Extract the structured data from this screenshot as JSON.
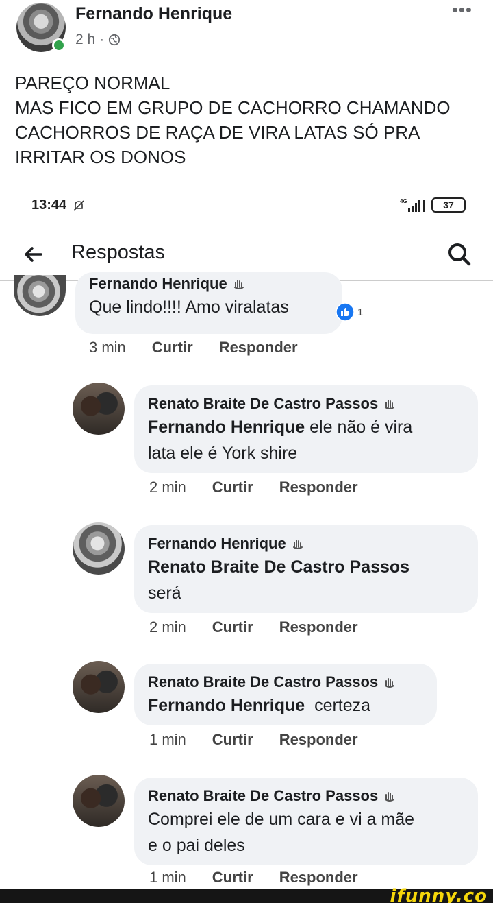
{
  "post": {
    "author": "Fernando Henrique",
    "time": "2 h",
    "separator": "·",
    "more": "•••",
    "text_lines": [
      "PAREÇO NORMAL",
      "MAS FICO EM GRUPO DE CACHORRO CHAMANDO",
      "CACHORROS DE RAÇA DE VIRA LATAS SÓ PRA",
      "IRRITAR OS DONOS"
    ]
  },
  "status_bar": {
    "time": "13:44",
    "network": "4G",
    "battery": "37"
  },
  "nav": {
    "title": "Respostas"
  },
  "comments": [
    {
      "author": "Fernando Henrique",
      "lines": [
        "Que lindo!!!! Amo viralatas"
      ],
      "likes": "1",
      "time": "3 min",
      "like_label": "Curtir",
      "reply_label": "Responder"
    },
    {
      "author": "Renato Braite De Castro Passos",
      "mention": "Fernando Henrique",
      "line1_rest": " ele não é vira",
      "line2": "lata ele é York shire",
      "time": "2 min",
      "like_label": "Curtir",
      "reply_label": "Responder"
    },
    {
      "author": "Fernando Henrique",
      "mention": "Renato Braite De Castro Passos",
      "line2": "será",
      "time": "2 min",
      "like_label": "Curtir",
      "reply_label": "Responder"
    },
    {
      "author": "Renato Braite De Castro Passos",
      "mention": "Fernando Henrique",
      "line1_rest": "  certeza",
      "time": "1 min",
      "like_label": "Curtir",
      "reply_label": "Responder"
    },
    {
      "author": "Renato Braite De Castro Passos",
      "lines": [
        "Comprei ele de um cara e vi a mãe",
        "e o pai deles"
      ],
      "time": "1 min",
      "like_label": "Curtir",
      "reply_label": "Responder"
    }
  ],
  "watermark": "ifunny.co",
  "colors": {
    "bubble": "#f0f2f5",
    "online": "#31a24c",
    "like_blue": "#1877f2",
    "watermark": "#f5d60a"
  }
}
